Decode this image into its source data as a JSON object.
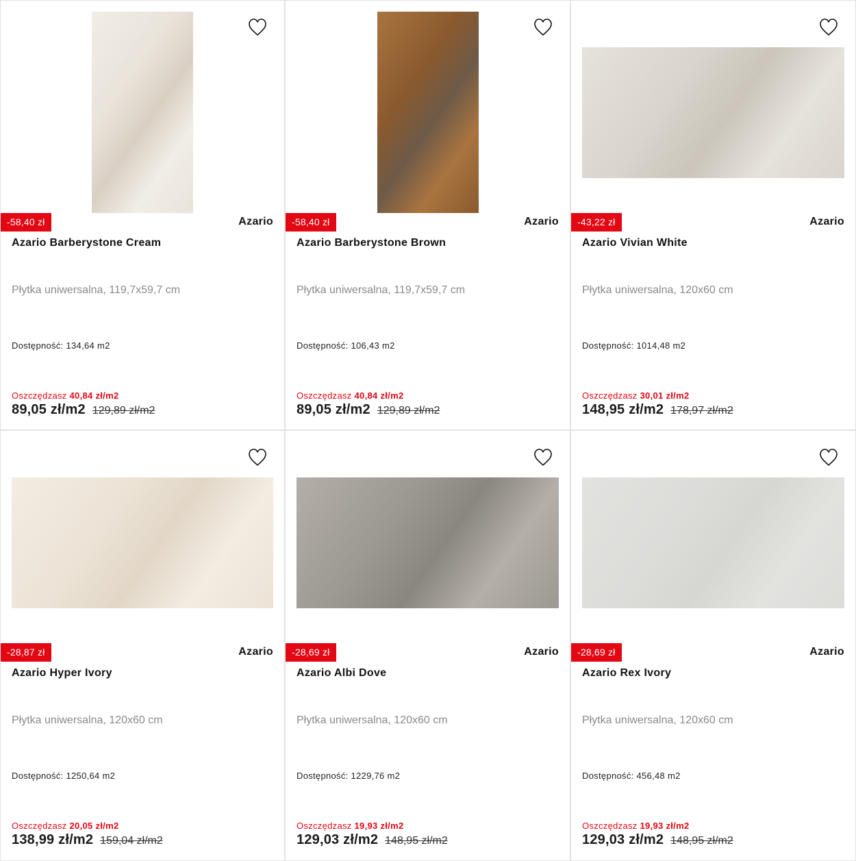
{
  "accent_color": "#e30613",
  "labels": {
    "availability": "Dostępność:",
    "savings": "Oszczędzasz"
  },
  "products": [
    {
      "discount": "-58,40 zł",
      "brand": "Azario",
      "name": "Azario Barberystone Cream",
      "description": "Płytka uniwersalna, 119,7x59,7 cm",
      "availability": "134,64 m2",
      "savings": "40,84 zł/m2",
      "price": "89,05 zł/m2",
      "old_price": "129,89 zł/m2",
      "icon": "heart-icon",
      "tile_colors": [
        "#e9e3da",
        "#d9d0c2",
        "#f1ede7"
      ]
    },
    {
      "discount": "-58,40 zł",
      "brand": "Azario",
      "name": "Azario Barberystone Brown",
      "description": "Płytka uniwersalna, 119,7x59,7 cm",
      "availability": "106,43 m2",
      "savings": "40,84 zł/m2",
      "price": "89,05 zł/m2",
      "old_price": "129,89 zł/m2",
      "icon": "heart-icon",
      "tile_colors": [
        "#8a5a2e",
        "#6e5a48",
        "#a9743f"
      ]
    },
    {
      "discount": "-43,22 zł",
      "brand": "Azario",
      "name": "Azario Vivian White",
      "description": "Płytka uniwersalna, 120x60 cm",
      "availability": "1014,48 m2",
      "savings": "30,01 zł/m2",
      "price": "148,95 zł/m2",
      "old_price": "178,97 zł/m2",
      "icon": "heart-icon",
      "tile_colors": [
        "#d9d4cc",
        "#cbc5bb",
        "#e6e2dc"
      ]
    },
    {
      "discount": "-28,87 zł",
      "brand": "Azario",
      "name": "Azario Hyper Ivory",
      "description": "Płytka uniwersalna, 120x60 cm",
      "availability": "1250,64 m2",
      "savings": "20,05 zł/m2",
      "price": "138,99 zł/m2",
      "old_price": "159,04 zł/m2",
      "icon": "heart-icon",
      "tile_colors": [
        "#ece3d6",
        "#e2d7c7",
        "#f3ece2"
      ]
    },
    {
      "discount": "-28,69 zł",
      "brand": "Azario",
      "name": "Azario Albi Dove",
      "description": "Płytka uniwersalna, 120x60 cm",
      "availability": "1229,76 m2",
      "savings": "19,93 zł/m2",
      "price": "129,03 zł/m2",
      "old_price": "148,95 zł/m2",
      "icon": "heart-icon",
      "tile_colors": [
        "#9c9892",
        "#8a8680",
        "#b4afa8"
      ]
    },
    {
      "discount": "-28,69 zł",
      "brand": "Azario",
      "name": "Azario Rex Ivory",
      "description": "Płytka uniwersalna, 120x60 cm",
      "availability": "456,48 m2",
      "savings": "19,93 zł/m2",
      "price": "129,03 zł/m2",
      "old_price": "148,95 zł/m2",
      "icon": "heart-icon",
      "tile_colors": [
        "#dcdcd9",
        "#d6d6d2",
        "#e2e2df"
      ]
    }
  ]
}
